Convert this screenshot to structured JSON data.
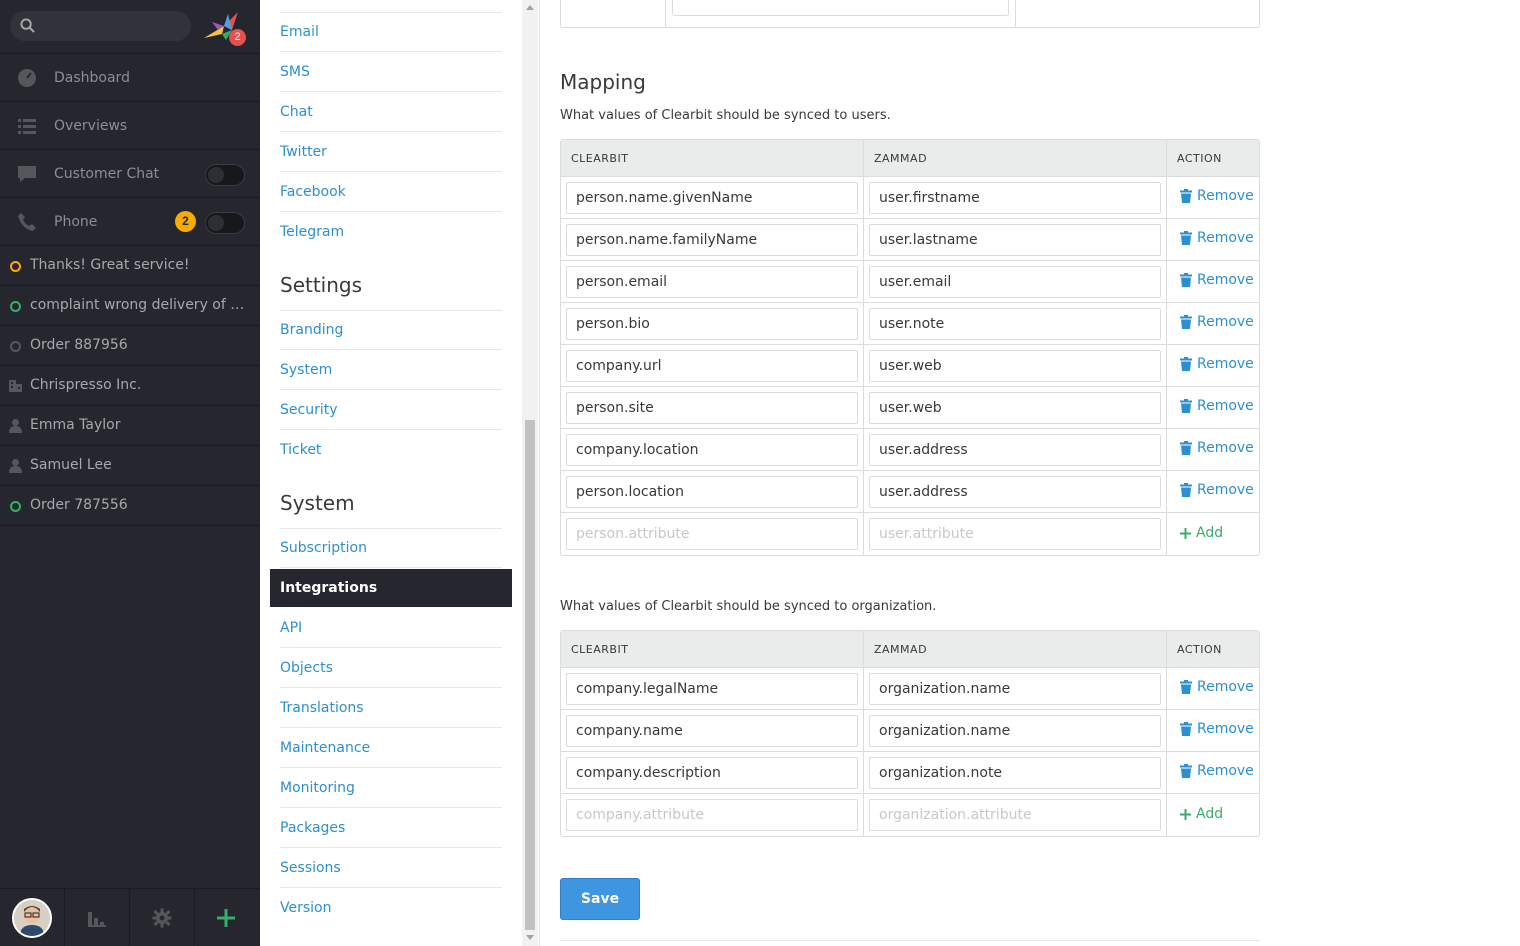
{
  "nav": {
    "notification_count": "2",
    "items": [
      {
        "label": "Dashboard",
        "icon": "dashboard-icon"
      },
      {
        "label": "Overviews",
        "icon": "list-icon"
      },
      {
        "label": "Customer Chat",
        "icon": "chat-icon"
      },
      {
        "label": "Phone",
        "icon": "phone-icon",
        "badge": "2"
      }
    ],
    "tasks": [
      {
        "label": "Thanks! Great service!",
        "icon": "ticket-open-icon"
      },
      {
        "label": "complaint wrong delivery of order",
        "icon": "ticket-new-icon"
      },
      {
        "label": "Order 887956",
        "icon": "ticket-closed-icon"
      },
      {
        "label": "Chrispresso Inc.",
        "icon": "organization-icon"
      },
      {
        "label": "Emma Taylor",
        "icon": "user-icon"
      },
      {
        "label": "Samuel Lee",
        "icon": "user-icon"
      },
      {
        "label": "Order 787556",
        "icon": "ticket-new-icon"
      }
    ]
  },
  "menu": {
    "channels": [
      "Email",
      "SMS",
      "Chat",
      "Twitter",
      "Facebook",
      "Telegram"
    ],
    "settings_heading": "Settings",
    "settings": [
      "Branding",
      "System",
      "Security",
      "Ticket"
    ],
    "system_heading": "System",
    "system": [
      "Subscription",
      "Integrations",
      "API",
      "Objects",
      "Translations",
      "Maintenance",
      "Monitoring",
      "Packages",
      "Sessions",
      "Version"
    ]
  },
  "main": {
    "title": "Mapping",
    "users_desc": "What values of Clearbit should be synced to users.",
    "org_desc": "What values of Clearbit should be synced to organization.",
    "headers": {
      "clearbit": "CLEARBIT",
      "zammad": "ZAMMAD",
      "action": "ACTION"
    },
    "remove_label": "Remove",
    "add_label": "Add",
    "save_label": "Save",
    "user_rows": [
      [
        "person.name.givenName",
        "user.firstname"
      ],
      [
        "person.name.familyName",
        "user.lastname"
      ],
      [
        "person.email",
        "user.email"
      ],
      [
        "person.bio",
        "user.note"
      ],
      [
        "company.url",
        "user.web"
      ],
      [
        "person.site",
        "user.web"
      ],
      [
        "company.location",
        "user.address"
      ],
      [
        "person.location",
        "user.address"
      ]
    ],
    "user_placeholders": [
      "person.attribute",
      "user.attribute"
    ],
    "org_rows": [
      [
        "company.legalName",
        "organization.name"
      ],
      [
        "company.name",
        "organization.name"
      ],
      [
        "company.description",
        "organization.note"
      ]
    ],
    "org_placeholders": [
      "company.attribute",
      "organization.attribute"
    ]
  },
  "colors": {
    "accent": "#2b8fd2",
    "nav_bg": "#26272e",
    "add": "#38ad69",
    "save": "#3e95e0"
  }
}
